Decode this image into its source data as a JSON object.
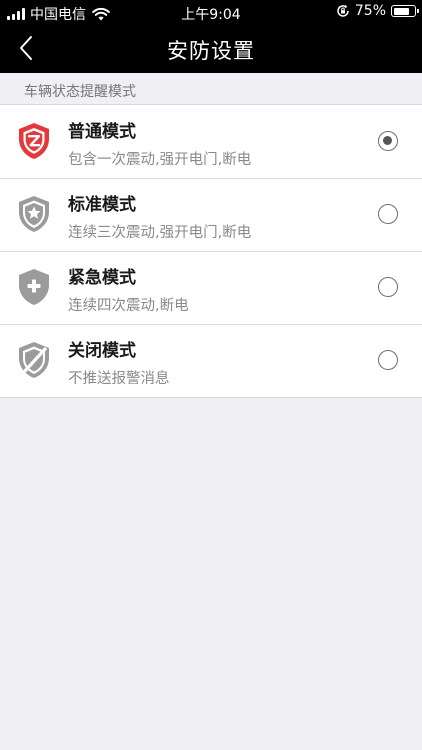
{
  "status_bar": {
    "carrier": "中国电信",
    "time": "上午9:04",
    "battery_percent": "75%",
    "battery_level": 0.75
  },
  "nav": {
    "title": "安防设置",
    "back_icon": "chevron-left-icon"
  },
  "section": {
    "header": "车辆状态提醒模式"
  },
  "modes": [
    {
      "title": "普通模式",
      "desc": "包含一次震动,强开电门,断电",
      "icon": "shield-alert-icon",
      "icon_color": "#e4393c",
      "selected": true
    },
    {
      "title": "标准模式",
      "desc": "连续三次震动,强开电门,断电",
      "icon": "shield-star-icon",
      "icon_color": "#9b9b9b",
      "selected": false
    },
    {
      "title": "紧急模式",
      "desc": "连续四次震动,断电",
      "icon": "shield-plus-icon",
      "icon_color": "#9b9b9b",
      "selected": false
    },
    {
      "title": "关闭模式",
      "desc": "不推送报警消息",
      "icon": "shield-off-icon",
      "icon_color": "#9b9b9b",
      "selected": false
    }
  ],
  "colors": {
    "bar_background": "#000000",
    "page_background": "#efeff4",
    "accent_red": "#e4393c"
  }
}
